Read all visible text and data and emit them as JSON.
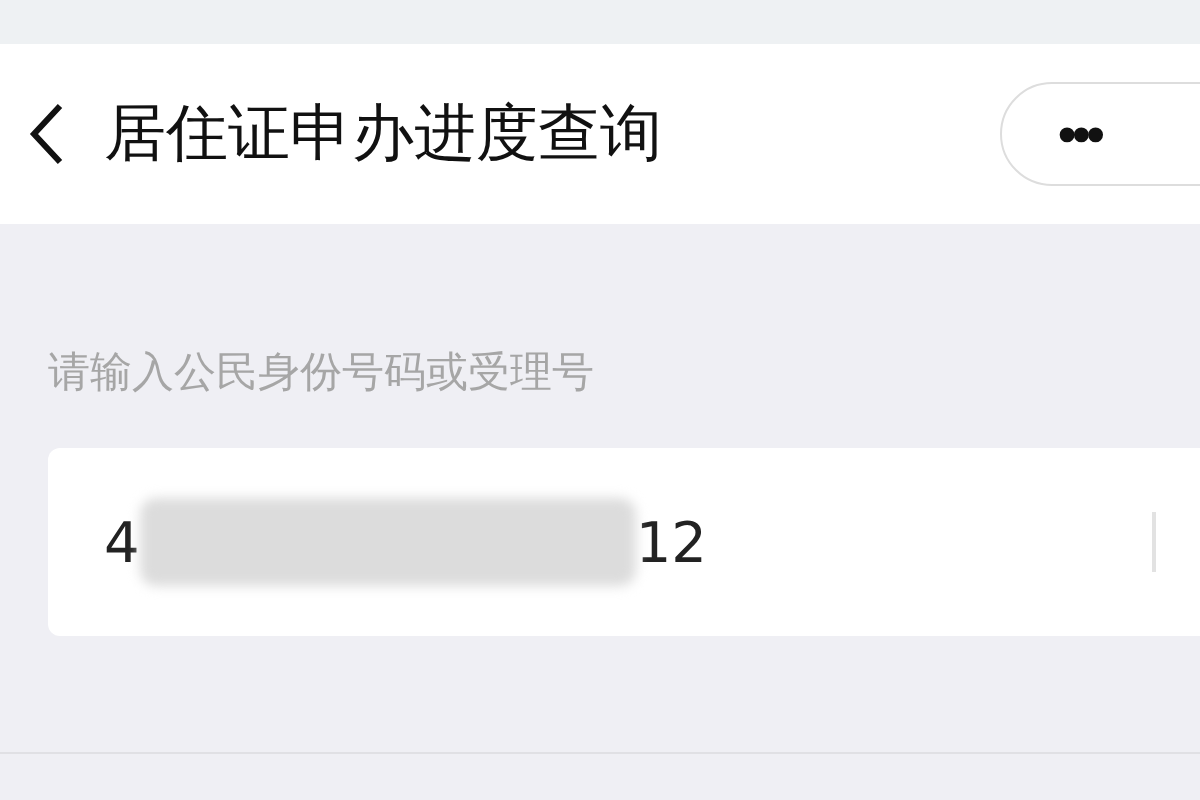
{
  "header": {
    "title": "居住证申办进度查询",
    "menu_icon": "•••"
  },
  "form": {
    "label": "请输入公民身份号码或受理号",
    "value_start": "4",
    "value_end": "12"
  }
}
